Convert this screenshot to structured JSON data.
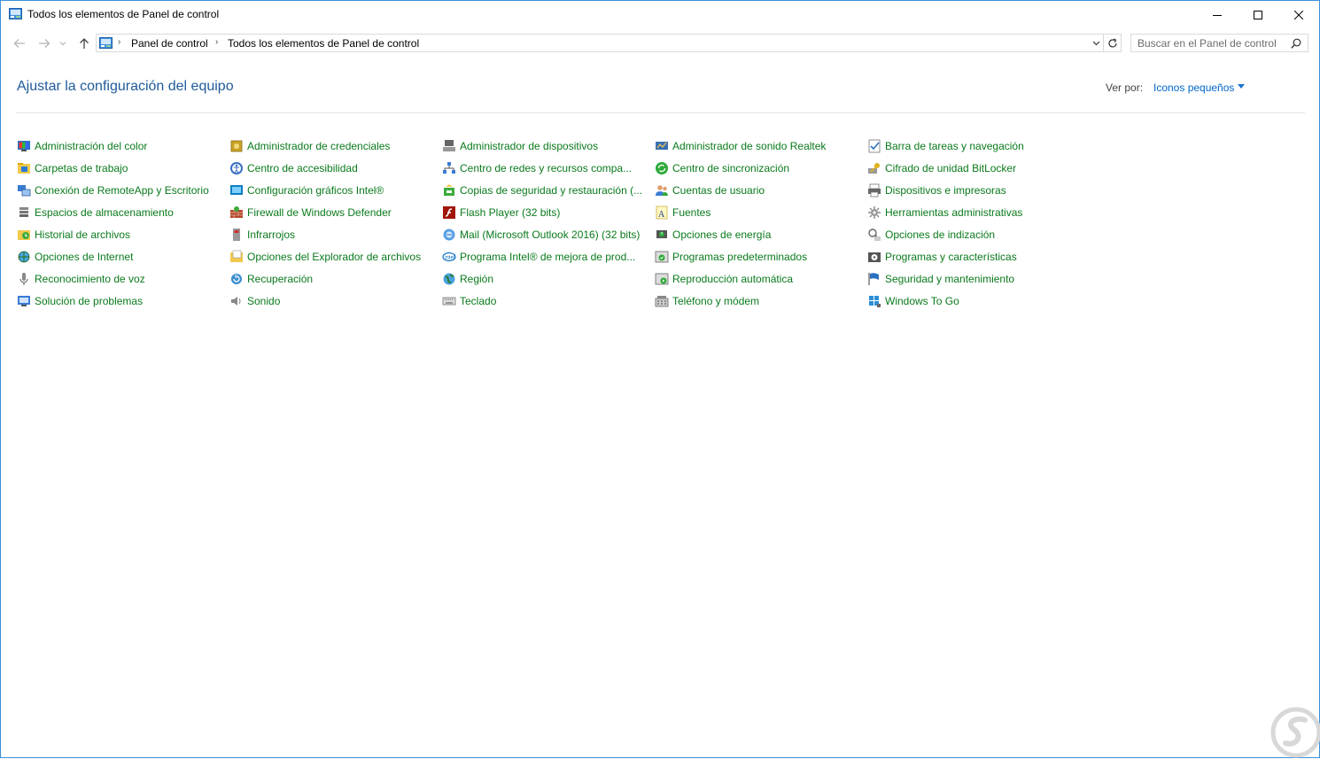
{
  "window": {
    "title": "Todos los elementos de Panel de control"
  },
  "address": {
    "crumbs": [
      "Panel de control",
      "Todos los elementos de Panel de control"
    ]
  },
  "search": {
    "placeholder": "Buscar en el Panel de control"
  },
  "header": {
    "title": "Ajustar la configuración del equipo",
    "view_by_label": "Ver por:",
    "view_by_value": "Iconos pequeños"
  },
  "colors": {
    "link_green": "#0a7a1c",
    "title_blue": "#1e5a9a",
    "accent_blue": "#0066cc",
    "window_border": "#3c8fd4"
  },
  "columns": [
    {
      "items": [
        {
          "label": "Administración del color",
          "icon": "color-monitor-icon"
        },
        {
          "label": "Carpetas de trabajo",
          "icon": "work-folders-icon"
        },
        {
          "label": "Conexión de RemoteApp y Escritorio",
          "icon": "remote-desktop-icon"
        },
        {
          "label": "Espacios de almacenamiento",
          "icon": "storage-icon"
        },
        {
          "label": "Historial de archivos",
          "icon": "file-history-icon"
        },
        {
          "label": "Opciones de Internet",
          "icon": "internet-globe-icon"
        },
        {
          "label": "Reconocimiento de voz",
          "icon": "microphone-icon"
        },
        {
          "label": "Solución de problemas",
          "icon": "troubleshoot-icon"
        }
      ]
    },
    {
      "items": [
        {
          "label": "Administrador de credenciales",
          "icon": "credentials-vault-icon"
        },
        {
          "label": "Centro de accesibilidad",
          "icon": "accessibility-icon"
        },
        {
          "label": "Configuración gráficos Intel®",
          "icon": "intel-graphics-icon"
        },
        {
          "label": "Firewall de Windows Defender",
          "icon": "firewall-icon"
        },
        {
          "label": "Infrarrojos",
          "icon": "infrared-icon"
        },
        {
          "label": "Opciones del Explorador de archivos",
          "icon": "folder-options-icon"
        },
        {
          "label": "Recuperación",
          "icon": "recovery-icon"
        },
        {
          "label": "Sonido",
          "icon": "speaker-icon"
        }
      ]
    },
    {
      "items": [
        {
          "label": "Administrador de dispositivos",
          "icon": "device-manager-icon"
        },
        {
          "label": "Centro de redes y recursos compa...",
          "icon": "network-icon"
        },
        {
          "label": "Copias de seguridad y restauración (...",
          "icon": "backup-icon"
        },
        {
          "label": "Flash Player (32 bits)",
          "icon": "flash-player-icon"
        },
        {
          "label": "Mail (Microsoft Outlook 2016) (32 bits)",
          "icon": "mail-icon"
        },
        {
          "label": "Programa Intel® de mejora de prod...",
          "icon": "intel-logo-icon"
        },
        {
          "label": "Región",
          "icon": "region-globe-icon"
        },
        {
          "label": "Teclado",
          "icon": "keyboard-icon"
        }
      ]
    },
    {
      "items": [
        {
          "label": "Administrador de sonido Realtek",
          "icon": "realtek-audio-icon"
        },
        {
          "label": "Centro de sincronización",
          "icon": "sync-icon"
        },
        {
          "label": "Cuentas de usuario",
          "icon": "user-accounts-icon"
        },
        {
          "label": "Fuentes",
          "icon": "fonts-icon"
        },
        {
          "label": "Opciones de energía",
          "icon": "power-options-icon"
        },
        {
          "label": "Programas predeterminados",
          "icon": "default-programs-icon"
        },
        {
          "label": "Reproducción automática",
          "icon": "autoplay-icon"
        },
        {
          "label": "Teléfono y módem",
          "icon": "phone-modem-icon"
        }
      ]
    },
    {
      "items": [
        {
          "label": "Barra de tareas y navegación",
          "icon": "taskbar-icon"
        },
        {
          "label": "Cifrado de unidad BitLocker",
          "icon": "bitlocker-key-icon"
        },
        {
          "label": "Dispositivos e impresoras",
          "icon": "printer-icon"
        },
        {
          "label": "Herramientas administrativas",
          "icon": "admin-tools-gear-icon"
        },
        {
          "label": "Opciones de indización",
          "icon": "indexing-icon"
        },
        {
          "label": "Programas y características",
          "icon": "programs-features-icon"
        },
        {
          "label": "Seguridad y mantenimiento",
          "icon": "security-flag-icon"
        },
        {
          "label": "Windows To Go",
          "icon": "windows-to-go-icon"
        }
      ]
    }
  ]
}
